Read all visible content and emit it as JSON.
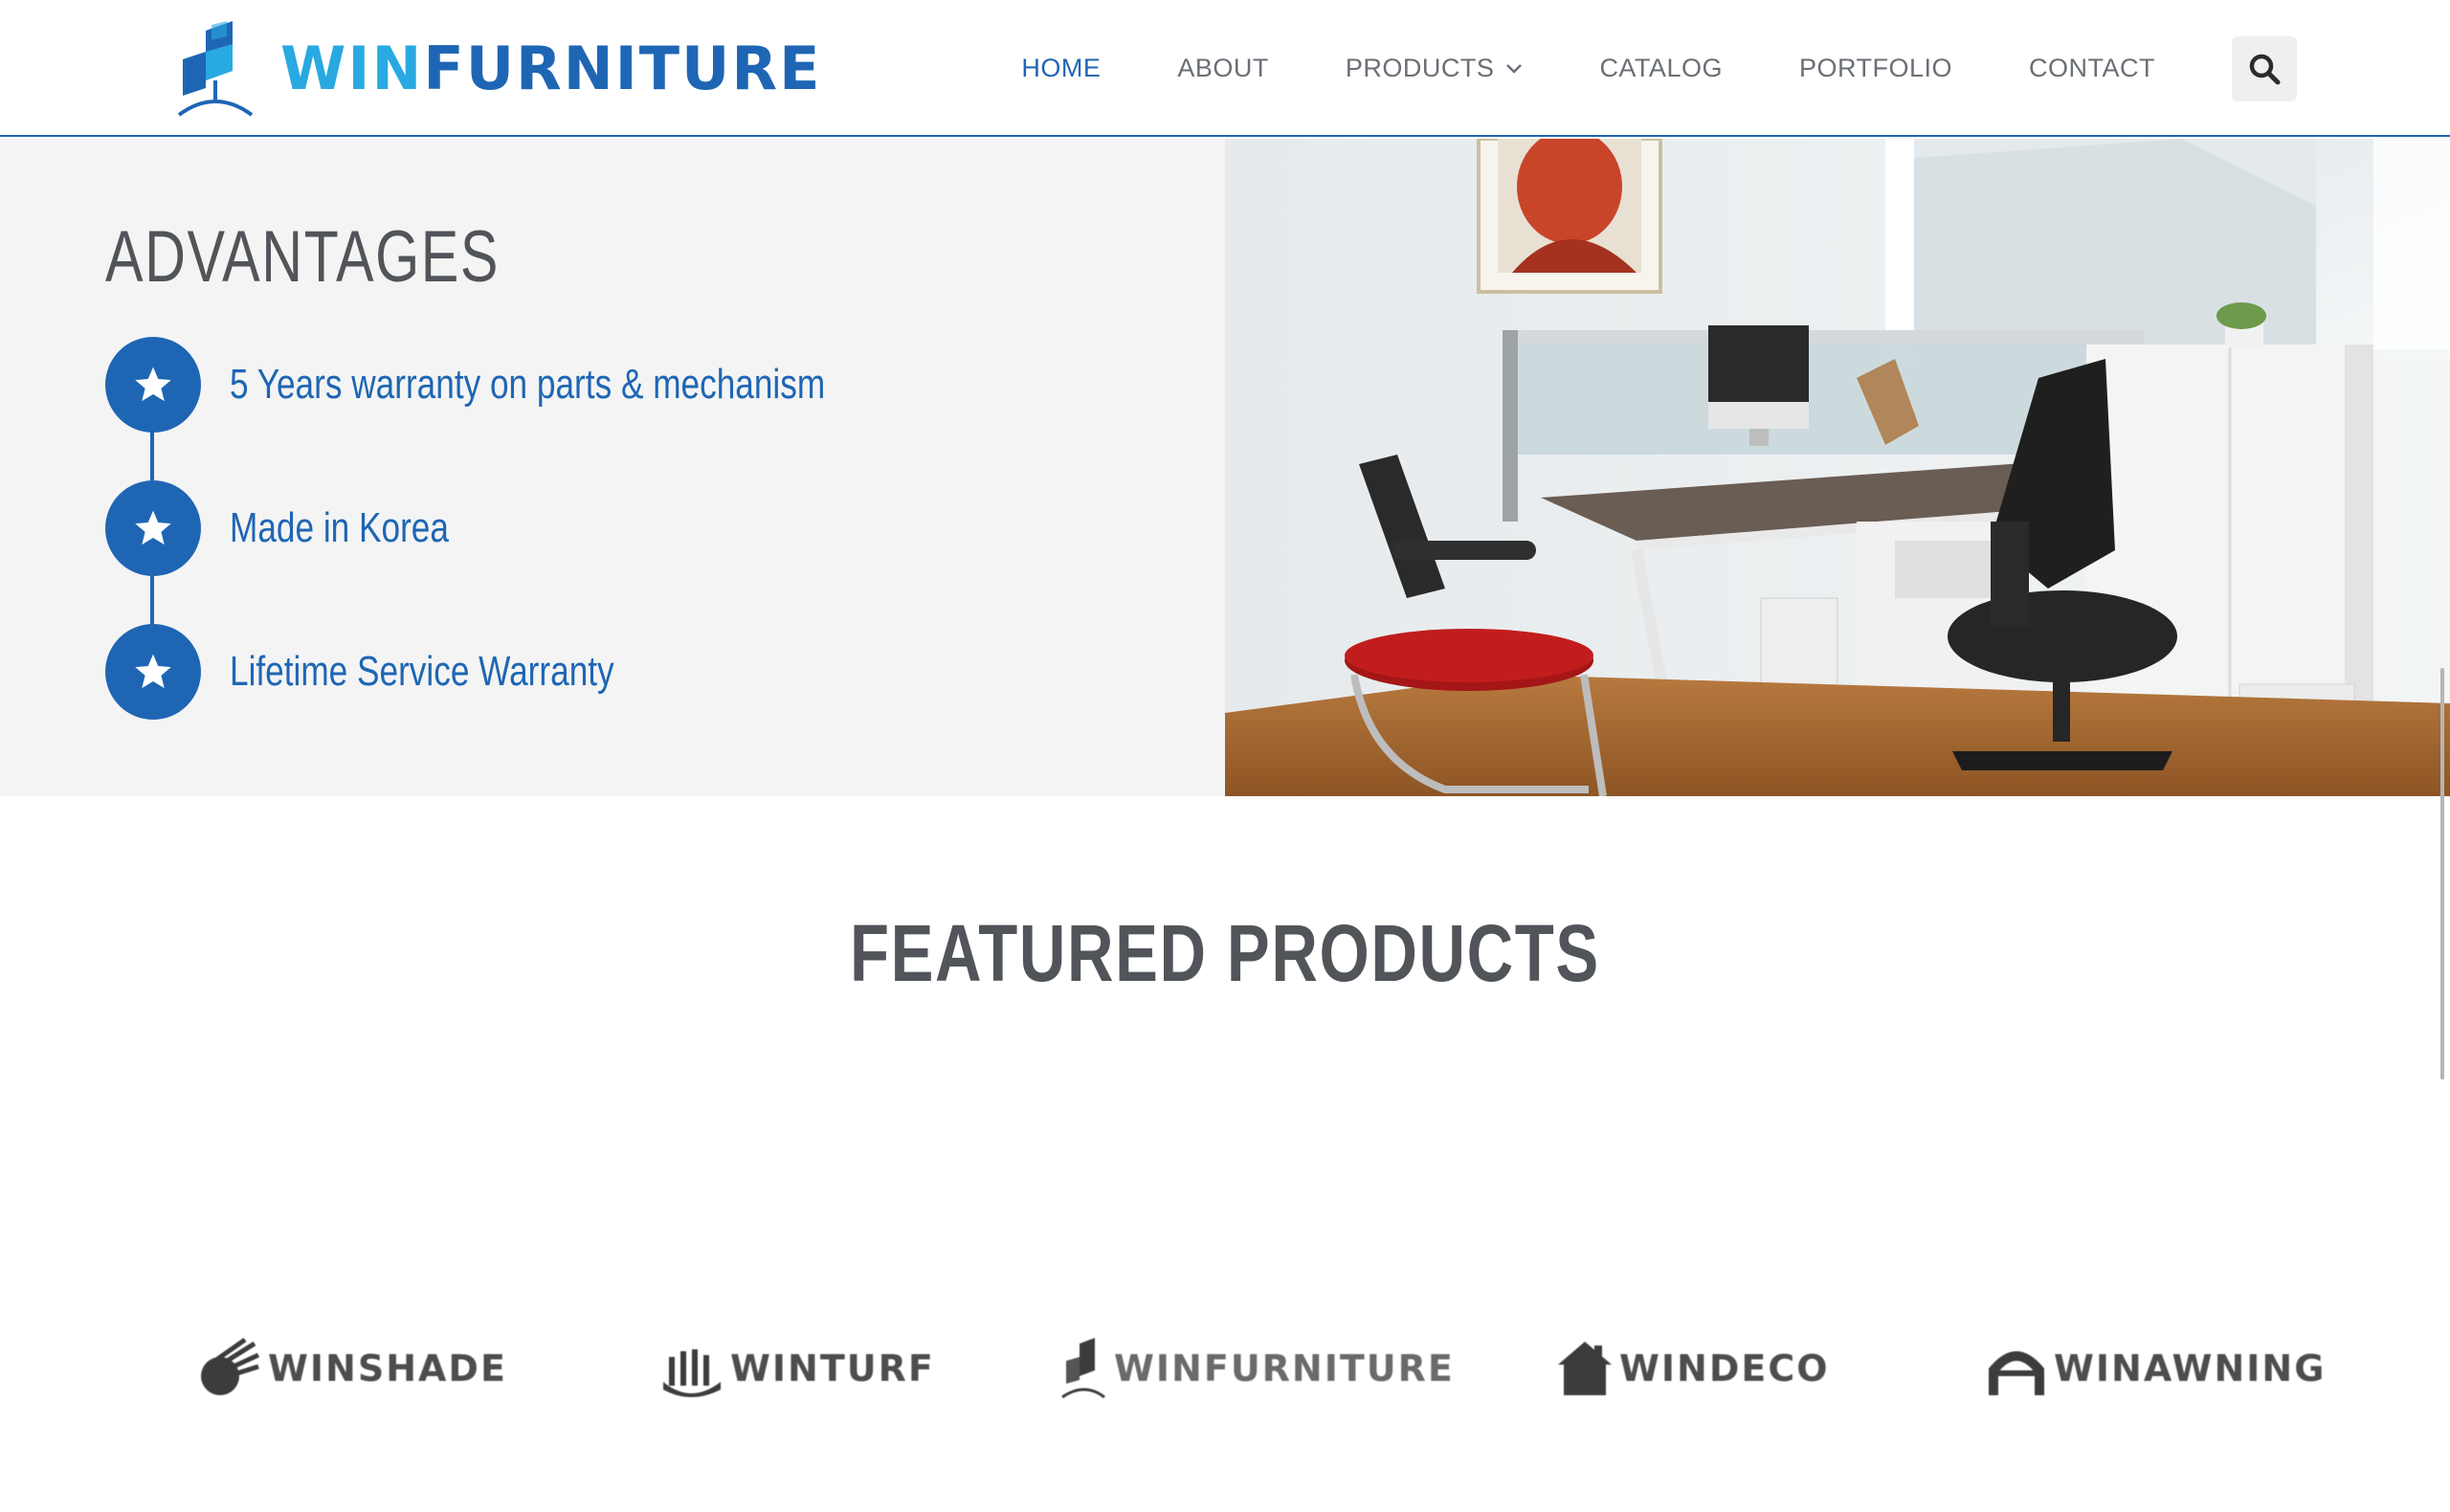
{
  "header": {
    "logo": {
      "prefix": "WIN",
      "suffix": "FURNITURE"
    },
    "nav": [
      {
        "label": "HOME",
        "active": true
      },
      {
        "label": "ABOUT",
        "active": false
      },
      {
        "label": "PRODUCTS",
        "active": false,
        "has_dropdown": true
      },
      {
        "label": "CATALOG",
        "active": false
      },
      {
        "label": "PORTFOLIO",
        "active": false
      },
      {
        "label": "CONTACT",
        "active": false
      }
    ],
    "search_icon": "search-icon"
  },
  "advantages": {
    "title": "ADVANTAGES",
    "items": [
      {
        "icon": "star-icon",
        "text": "5 Years warranty on parts & mechanism"
      },
      {
        "icon": "star-icon",
        "text": "Made in Korea"
      },
      {
        "icon": "star-icon",
        "text": "Lifetime Service Warranty"
      }
    ]
  },
  "featured": {
    "title": "FEATURED PRODUCTS",
    "brands": [
      {
        "name": "WINSHADE",
        "icon": "shade-icon"
      },
      {
        "name": "WINTURF",
        "icon": "turf-icon"
      },
      {
        "name": "WINFURNITURE",
        "icon": "furniture-icon"
      },
      {
        "name": "WINDECO",
        "icon": "house-icon"
      },
      {
        "name": "WINAWNING",
        "icon": "awning-icon"
      }
    ]
  },
  "colors": {
    "brand_blue": "#1e66b4",
    "brand_light_blue": "#29a9e1",
    "text_gray": "#515459",
    "nav_gray": "#6a6f75"
  }
}
